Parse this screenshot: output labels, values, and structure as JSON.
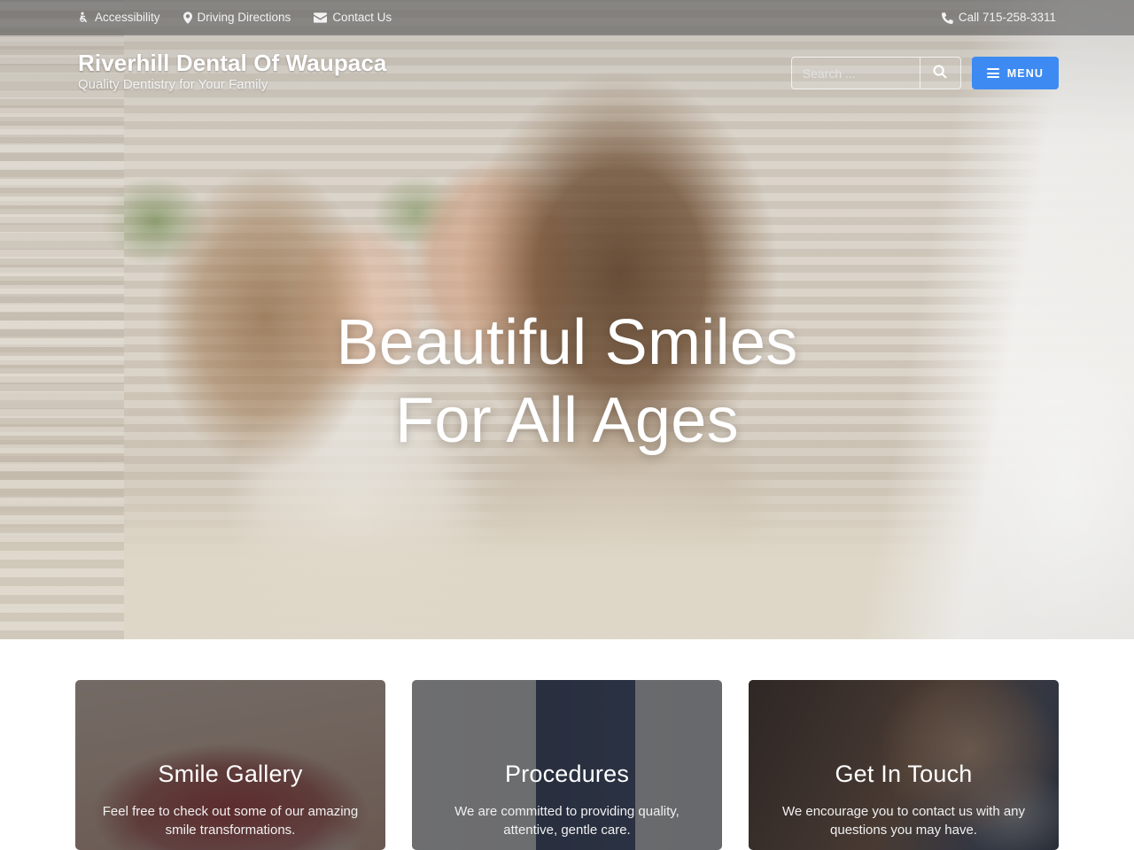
{
  "topbar": {
    "links": [
      {
        "label": "Accessibility",
        "icon": "wheelchair-icon"
      },
      {
        "label": "Driving Directions",
        "icon": "map-pin-icon"
      },
      {
        "label": "Contact Us",
        "icon": "envelope-icon"
      }
    ],
    "phone": {
      "label": "Call 715-258-3311",
      "icon": "phone-icon"
    }
  },
  "header": {
    "brand_title": "Riverhill Dental Of Waupaca",
    "brand_tagline": "Quality Dentistry for Your Family",
    "search": {
      "placeholder": "Search ...",
      "value": "",
      "button_icon": "search-icon"
    },
    "menu": {
      "label": "MENU",
      "icon": "hamburger-icon",
      "color": "#3d8bf2"
    }
  },
  "hero": {
    "headline_line1": "Beautiful Smiles",
    "headline_line2": "For All Ages"
  },
  "cards": [
    {
      "title": "Smile Gallery",
      "text": "Feel free to check out some of our amazing smile transformations."
    },
    {
      "title": "Procedures",
      "text": "We are committed to providing quality, attentive, gentle care."
    },
    {
      "title": "Get In Touch",
      "text": "We encourage you to contact us with any questions you may have."
    }
  ]
}
